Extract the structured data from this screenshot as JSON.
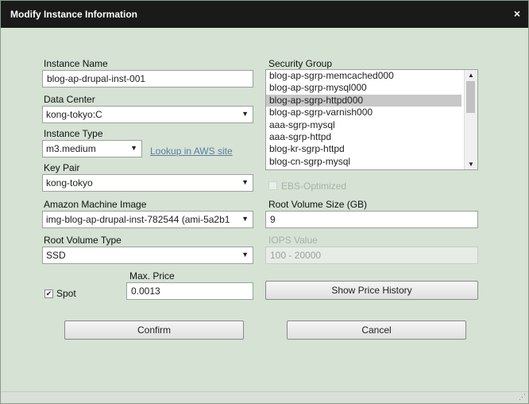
{
  "dialog": {
    "title": "Modify Instance Information",
    "close_glyph": "×"
  },
  "instance_name": {
    "label": "Instance Name",
    "value": "blog-ap-drupal-inst-001"
  },
  "data_center": {
    "label": "Data Center",
    "value": "kong-tokyo:C"
  },
  "instance_type": {
    "label": "Instance Type",
    "value": "m3.medium",
    "lookup_link": "Lookup in AWS site"
  },
  "key_pair": {
    "label": "Key Pair",
    "value": "kong-tokyo"
  },
  "ami": {
    "label": "Amazon Machine Image",
    "value": "img-blog-ap-drupal-inst-782544 (ami-5a2b1"
  },
  "root_volume_type": {
    "label": "Root Volume Type",
    "value": "SSD"
  },
  "spot": {
    "label": "Spot",
    "checked": true
  },
  "max_price": {
    "label": "Max. Price",
    "value": "0.0013"
  },
  "security_group": {
    "label": "Security Group",
    "items": [
      "blog-ap-sgrp-memcached000",
      "blog-ap-sgrp-mysql000",
      "blog-ap-sgrp-httpd000",
      "blog-ap-sgrp-varnish000",
      "aaa-sgrp-mysql",
      "aaa-sgrp-httpd",
      "blog-kr-sgrp-httpd",
      "blog-cn-sgrp-mysql"
    ],
    "selected_index": 2
  },
  "ebs_optimized": {
    "label": "EBS-Optimized",
    "checked": false
  },
  "root_volume_size": {
    "label": "Root Volume Size (GB)",
    "value": "9"
  },
  "iops": {
    "label": "IOPS Value",
    "placeholder": "100 - 20000"
  },
  "buttons": {
    "price_history": "Show Price History",
    "confirm": "Confirm",
    "cancel": "Cancel"
  }
}
